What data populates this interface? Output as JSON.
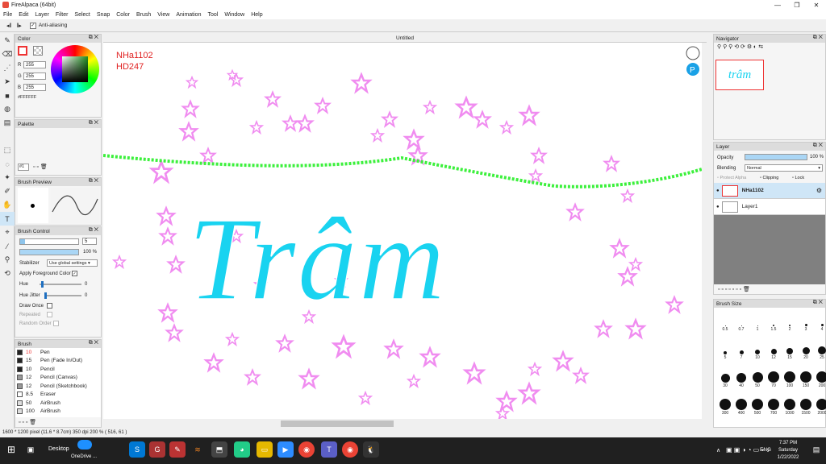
{
  "window": {
    "title": "FireAlpaca (64bit)",
    "buttons": [
      "—",
      "❐",
      "✕"
    ]
  },
  "menu": [
    "File",
    "Edit",
    "Layer",
    "Filter",
    "Select",
    "Snap",
    "Color",
    "Brush",
    "View",
    "Animation",
    "Tool",
    "Window",
    "Help"
  ],
  "toolbar": {
    "antialias_label": "Anti-aliasing",
    "antialias_checked": true
  },
  "color_panel": {
    "title": "Color",
    "r_label": "R",
    "r": "255",
    "g_label": "G",
    "g": "255",
    "b_label": "B",
    "b": "255",
    "hex": "#FFFFFF"
  },
  "palette_panel": {
    "title": "Palette",
    "page": "#1"
  },
  "brush_preview": {
    "title": "Brush Preview"
  },
  "brush_control": {
    "title": "Brush Control",
    "size": "5",
    "opacity": "100 %",
    "stabilizer_label": "Stabilizer",
    "stabilizer_value": "Use global settings",
    "apply_fg_label": "Apply Foreground Color",
    "hue_label": "Hue",
    "hue": "0",
    "hue_jitter_label": "Hue Jitter",
    "hue_jitter": "0",
    "draw_once_label": "Draw Once",
    "repeated_label": "Repeated",
    "random_order_label": "Random Order"
  },
  "brush_panel": {
    "title": "Brush",
    "items": [
      {
        "size": "10",
        "name": "Pen",
        "active": true
      },
      {
        "size": "15",
        "name": "Pen (Fade In/Out)",
        "active": false
      },
      {
        "size": "10",
        "name": "Pencil",
        "active": false
      },
      {
        "size": "12",
        "name": "Pencil (Canvas)",
        "active": false
      },
      {
        "size": "12",
        "name": "Pencil (Sketchbook)",
        "active": false
      },
      {
        "size": "8.5",
        "name": "Eraser",
        "active": false
      },
      {
        "size": "50",
        "name": "AirBrush",
        "active": false
      },
      {
        "size": "100",
        "name": "AirBrush",
        "active": false
      }
    ]
  },
  "document": {
    "tab": "Untitled",
    "corner_text_1": "NHa1102",
    "corner_text_2": "HD247",
    "artwork_text": "Trâm"
  },
  "navigator": {
    "title": "Navigator",
    "preview_text": "trâm"
  },
  "layer_panel": {
    "title": "Layer",
    "opacity_label": "Opacity",
    "opacity": "100 %",
    "blending_label": "Blending",
    "blending": "Normal",
    "protect_alpha": "Protect Alpha",
    "clipping": "Clipping",
    "lock": "Lock",
    "layers": [
      {
        "name": "NHa1102",
        "selected": true
      },
      {
        "name": "Layer1",
        "selected": false
      }
    ]
  },
  "brush_size_panel": {
    "title": "Brush Size",
    "sizes": [
      "0.5",
      "0.7",
      "1",
      "1.5",
      "2",
      "3",
      "4",
      "5",
      "7",
      "10",
      "12",
      "15",
      "20",
      "25",
      "30",
      "40",
      "50",
      "70",
      "100",
      "150",
      "200",
      "300",
      "400",
      "500",
      "700",
      "1000",
      "1500",
      "2000"
    ]
  },
  "status": "1600 * 1200 pixel  (11.6 * 8.7cm)  350 dpi  200 %  ( 516, 61 )",
  "taskbar": {
    "desktop": "Desktop",
    "onedrive": "OneDrive ...",
    "lang": "ENG",
    "time": "7:37 PM",
    "day": "Saturday",
    "date": "1/22/2022"
  },
  "colors": {
    "stroke_cyan": "#19d3f0",
    "garland_green": "#3cf03c",
    "star_pink": "#f08cf0",
    "red_text": "#e02020"
  }
}
